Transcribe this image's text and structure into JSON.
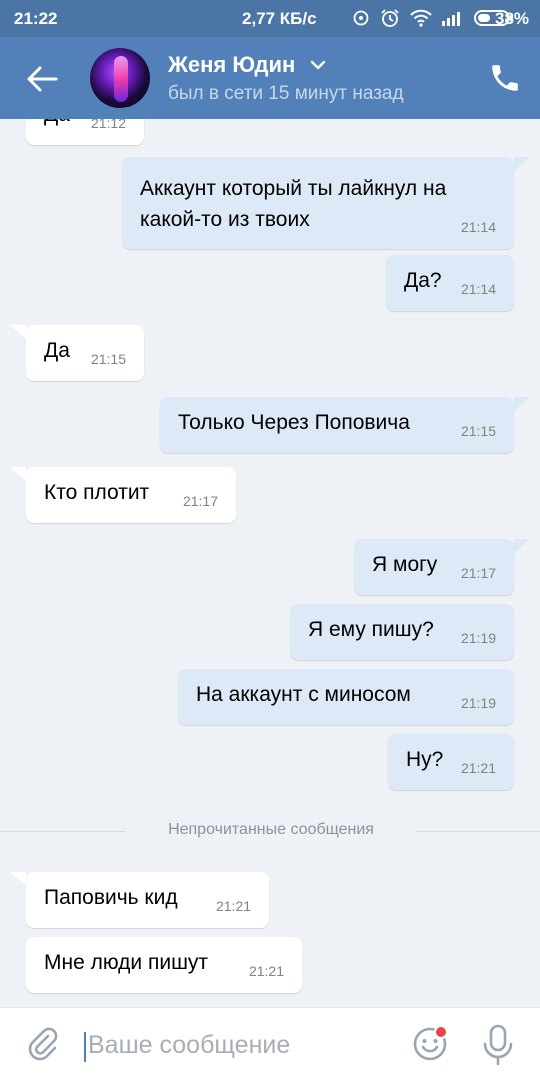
{
  "status_bar": {
    "time": "21:22",
    "network_speed": "2,77 КБ/с",
    "battery_percent": "38%",
    "icons": [
      "sync-icon",
      "alarm-icon",
      "wifi-icon",
      "signal-icon",
      "battery-icon"
    ]
  },
  "header": {
    "contact_name": "Женя Юдин",
    "presence": "был в сети 15 минут назад",
    "icons": {
      "back": "back-arrow-icon",
      "call": "phone-icon",
      "expand": "chevron-down-icon"
    },
    "colors": {
      "header_bg": "#5181b8",
      "status_bg": "#4a75a5"
    }
  },
  "messages": [
    {
      "dir": "in",
      "text": "Да",
      "time": "21:12"
    },
    {
      "dir": "out",
      "text": "Аккаунт который ты лайкнул на какой-то из твоих",
      "time": "21:14"
    },
    {
      "dir": "out",
      "text": "Да?",
      "time": "21:14"
    },
    {
      "dir": "in",
      "text": "Да",
      "time": "21:15"
    },
    {
      "dir": "out",
      "text": "Только Через Поповича",
      "time": "21:15"
    },
    {
      "dir": "in",
      "text": "Кто плотит",
      "time": "21:17"
    },
    {
      "dir": "out",
      "text": "Я могу",
      "time": "21:17"
    },
    {
      "dir": "out",
      "text": "Я ему пишу?",
      "time": "21:19"
    },
    {
      "dir": "out",
      "text": "На аккаунт с миносом",
      "time": "21:19"
    },
    {
      "dir": "out",
      "text": "Ну?",
      "time": "21:21"
    },
    {
      "dir": "in",
      "text": "Паповичь кид",
      "time": "21:21"
    },
    {
      "dir": "in",
      "text": "Мне люди пишут",
      "time": "21:21"
    }
  ],
  "unread_divider": "Непрочитанные сообщения",
  "composer": {
    "placeholder": "Ваше сообщение",
    "icons": [
      "paperclip-icon",
      "emoji-icon",
      "microphone-icon"
    ]
  },
  "colors": {
    "chat_bg": "#eef1f5",
    "incoming_bubble": "#ffffff",
    "outgoing_bubble": "#dde9f7",
    "accent": "#5181b8",
    "badge_red": "#e64646"
  }
}
